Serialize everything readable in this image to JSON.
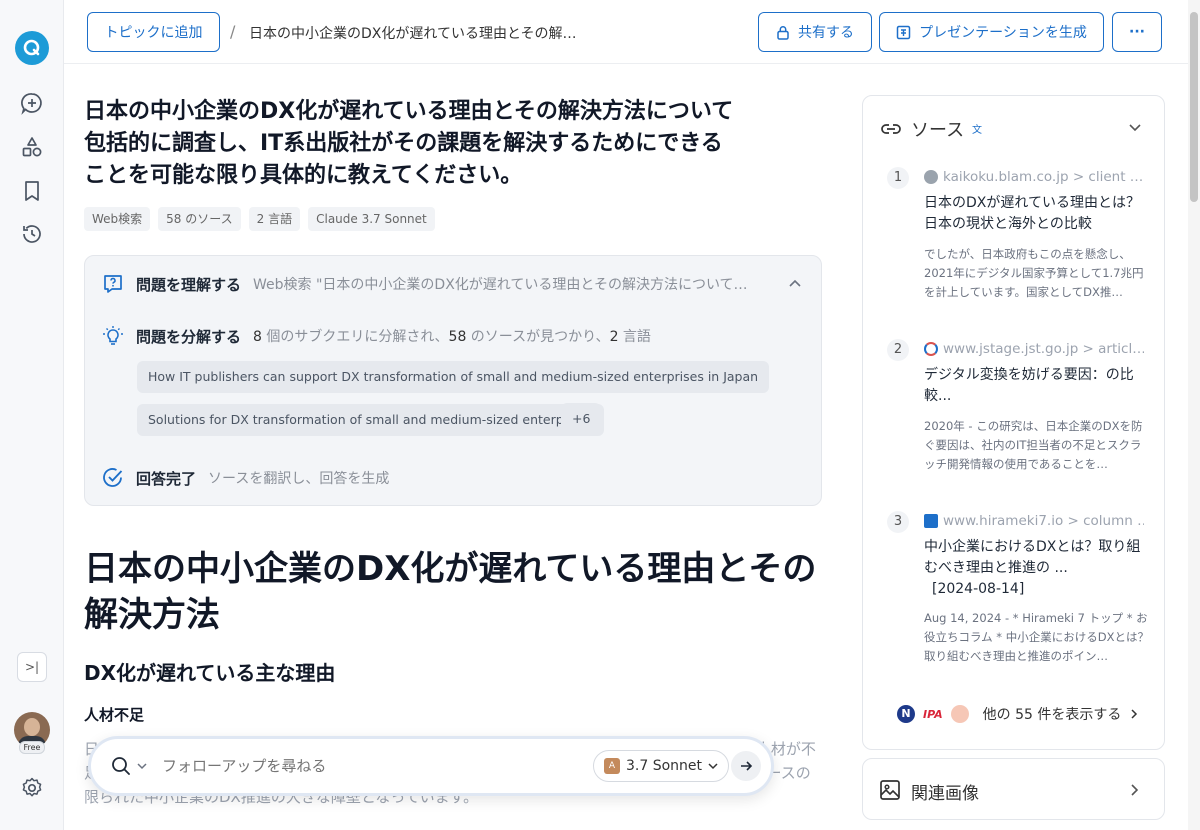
{
  "topbar": {
    "add_topic": "トピックに追加",
    "breadcrumb_sep": "/",
    "breadcrumb_title": "日本の中小企業のDX化が遅れている理由とその解…",
    "share": "共有する",
    "presentation": "プレゼンテーションを生成",
    "more": "···"
  },
  "sidebar": {
    "collapse": ">|",
    "badge": "Free"
  },
  "question": {
    "title": "日本の中小企業のDX化が遅れている理由とその解決方法について包括的に調査し、IT系出版社がその課題を解決するためにできることを可能な限り具体的に教えてください。",
    "chips": [
      "Web検索",
      "58 のソース",
      "2 言語",
      "Claude 3.7 Sonnet"
    ]
  },
  "steps": {
    "understand_label": "問題を理解する",
    "understand_desc": "Web検索 \"日本の中小企業のDX化が遅れている理由とその解決方法について包…",
    "decompose_label": "問題を分解する",
    "decompose_n1": "8",
    "decompose_t1": " 個のサブクエリに分解され、",
    "decompose_n2": "58",
    "decompose_t2": " のソースが見つかり、",
    "decompose_n3": "2",
    "decompose_t3": " 言語",
    "subqueries": [
      "How IT publishers can support DX transformation of small and medium-sized enterprises in Japan",
      "Solutions for DX transformation of small and medium-sized enterprises"
    ],
    "more_count": "+6",
    "done_label": "回答完了",
    "done_desc": "ソースを翻訳し、回答を生成"
  },
  "answer": {
    "h1": "日本の中小企業のDX化が遅れている理由とその解決方法",
    "h2": "DX化が遅れている主な理由",
    "h3": "人材不足",
    "body": "日本の中小企業におけるDX化の最大の障壁は、デジタル人材の不足です。多くの中小企業では、DX人材が不足しており、採用も困難である状況です。日本のIT人材は大企業やIT企業に集中しており、これがリソースの限られた中小企業のDX推進の大きな障壁となっています。"
  },
  "followup": {
    "placeholder": "フォローアップを尋ねる",
    "model": "3.7 Sonnet"
  },
  "sources": {
    "heading": "ソース",
    "items": [
      {
        "num": "1",
        "url": "kaikoku.blam.co.jp > client …",
        "title": "日本のDXが遅れている理由とは？日本の現状と海外との比較",
        "snippet": "でしたが、日本政府もこの点を懸念し、2021年にデジタル国家予算として1.7兆円を計上しています。国家としてDX推…"
      },
      {
        "num": "2",
        "url": "www.jstage.jst.go.jp > articl…",
        "title": "デジタル変換を妨げる要因：の比較...",
        "snippet": "2020年 - この研究は、日本企業のDXを防ぐ要因は、社内のIT担当者の不足とスクラッチ開発情報の使用であることを…"
      },
      {
        "num": "3",
        "url": "www.hirameki7.io > column …",
        "title": "中小企業におけるDXとは？取り組むべき理由と推進の ...",
        "date": "[2024-08-14]",
        "snippet": "Aug 14, 2024 - * Hirameki 7 トップ * お役立ちコラム * 中小企業におけるDXとは？取り組むべき理由と推進のポイン…"
      }
    ],
    "ipa_label": "IPA",
    "more_label": "他の 55 件を表示する"
  },
  "images_panel": {
    "label": "関連画像"
  },
  "colors": {
    "accent": "#1d6fc9",
    "logo": "#1d9bd7"
  }
}
